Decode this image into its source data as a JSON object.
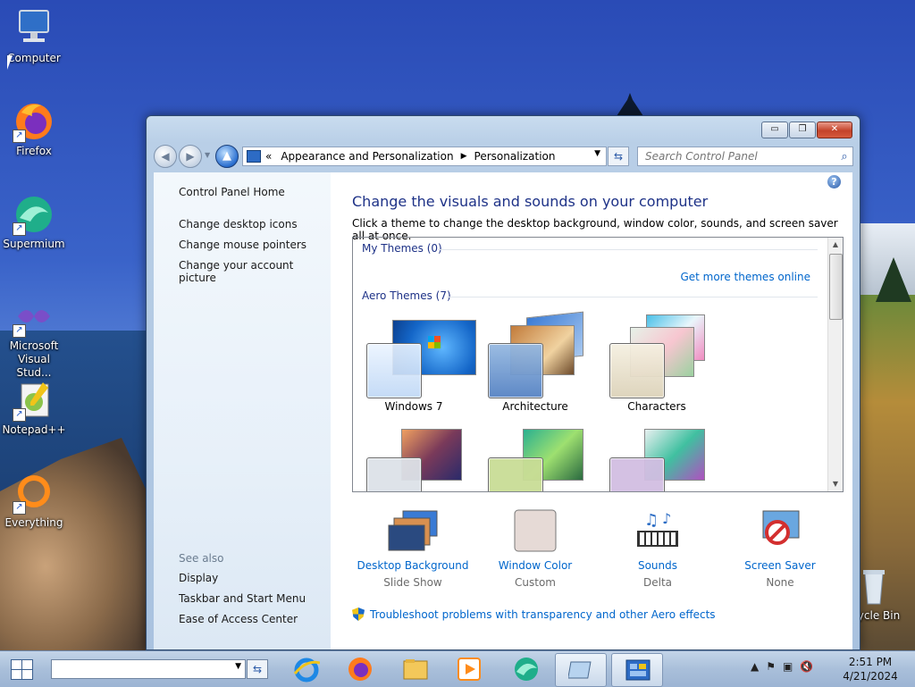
{
  "desktop": {
    "icons": [
      {
        "label": "Computer"
      },
      {
        "label": "Firefox"
      },
      {
        "label": "Supermium"
      },
      {
        "label": "Microsoft Visual Stud..."
      },
      {
        "label": "Notepad++"
      },
      {
        "label": "Everything"
      },
      {
        "label": "Recycle Bin"
      }
    ]
  },
  "window": {
    "controls": {
      "minimize": "▭",
      "maximize": "❐",
      "close": "✕"
    },
    "address": {
      "prefix": "«",
      "crumbs": [
        "Appearance and Personalization",
        "Personalization"
      ]
    },
    "search": {
      "placeholder": "Search Control Panel"
    },
    "sidebar": {
      "home": "Control Panel Home",
      "links": [
        "Change desktop icons",
        "Change mouse pointers",
        "Change your account picture"
      ],
      "see_also_label": "See also",
      "see_also": [
        "Display",
        "Taskbar and Start Menu",
        "Ease of Access Center"
      ]
    },
    "main": {
      "title": "Change the visuals and sounds on your computer",
      "subtitle": "Click a theme to change the desktop background, window color, sounds, and screen saver all at once.",
      "my_themes": "My Themes (0)",
      "get_more": "Get more themes online",
      "aero_themes": "Aero Themes (7)",
      "themes": [
        "Windows 7",
        "Architecture",
        "Characters"
      ],
      "bottom": [
        {
          "name": "Desktop Background",
          "value": "Slide Show"
        },
        {
          "name": "Window Color",
          "value": "Custom"
        },
        {
          "name": "Sounds",
          "value": "Delta"
        },
        {
          "name": "Screen Saver",
          "value": "None"
        }
      ],
      "troubleshoot": "Troubleshoot problems with transparency and other Aero effects",
      "help": "?"
    }
  },
  "taskbar": {
    "clock_time": "2:51 PM",
    "clock_date": "4/21/2024"
  }
}
